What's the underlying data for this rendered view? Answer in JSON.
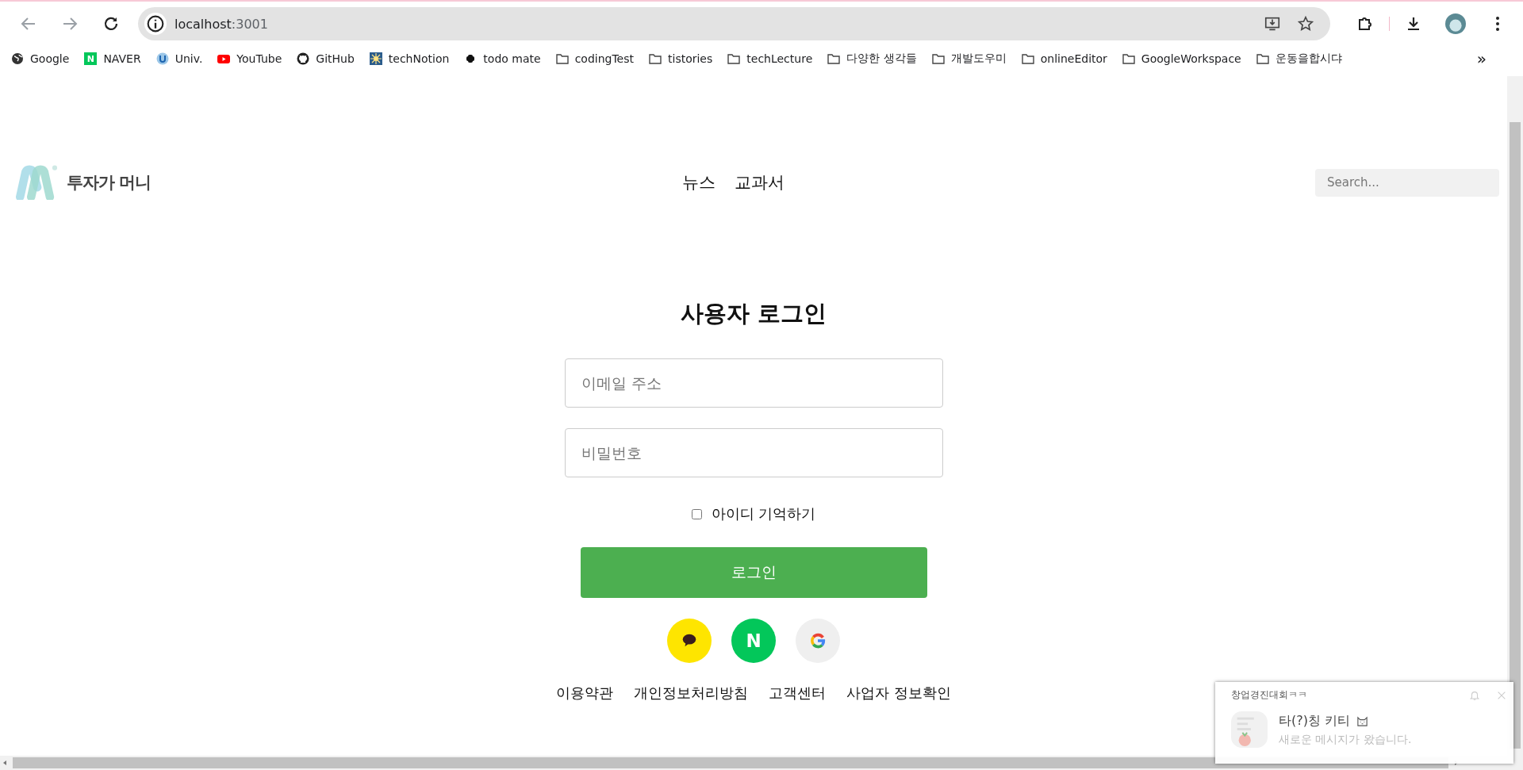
{
  "browser": {
    "url_host": "localhost",
    "url_port": ":3001",
    "bookmarks": [
      {
        "label": "Google",
        "kind": "globe"
      },
      {
        "label": "NAVER",
        "kind": "naver",
        "badge": "N"
      },
      {
        "label": "Univ.",
        "kind": "univ"
      },
      {
        "label": "YouTube",
        "kind": "youtube"
      },
      {
        "label": "GitHub",
        "kind": "github"
      },
      {
        "label": "techNotion",
        "kind": "sun"
      },
      {
        "label": "todo mate",
        "kind": "todo"
      },
      {
        "label": "codingTest",
        "kind": "folder"
      },
      {
        "label": "tistories",
        "kind": "folder"
      },
      {
        "label": "techLecture",
        "kind": "folder"
      },
      {
        "label": "다양한 생각들",
        "kind": "folder"
      },
      {
        "label": "개발도우미",
        "kind": "folder"
      },
      {
        "label": "onlineEditor",
        "kind": "folder"
      },
      {
        "label": "GoogleWorkspace",
        "kind": "folder"
      },
      {
        "label": "운동을합시댜",
        "kind": "folder"
      }
    ],
    "more": "»"
  },
  "header": {
    "logo_text": "투자가 머니",
    "nav": [
      "뉴스",
      "교과서"
    ],
    "search": {
      "placeholder": "Search..."
    }
  },
  "login": {
    "title": "사용자 로그인",
    "email": {
      "placeholder": "이메일 주소"
    },
    "password": {
      "placeholder": "비밀번호"
    },
    "remember": {
      "label": "아이디 기억하기",
      "checked": false
    },
    "submit": "로그인",
    "social": [
      {
        "kind": "kakao"
      },
      {
        "kind": "naver",
        "label": "N"
      },
      {
        "kind": "google"
      }
    ],
    "footer_links": [
      "이용약관",
      "개인정보처리방침",
      "고객센터",
      "사업자 정보확인"
    ]
  },
  "notification": {
    "title": "창업경진대회ㅋㅋ",
    "sender": "타(?)칭 키티",
    "message": "새로운 메시지가 왔습니다."
  }
}
